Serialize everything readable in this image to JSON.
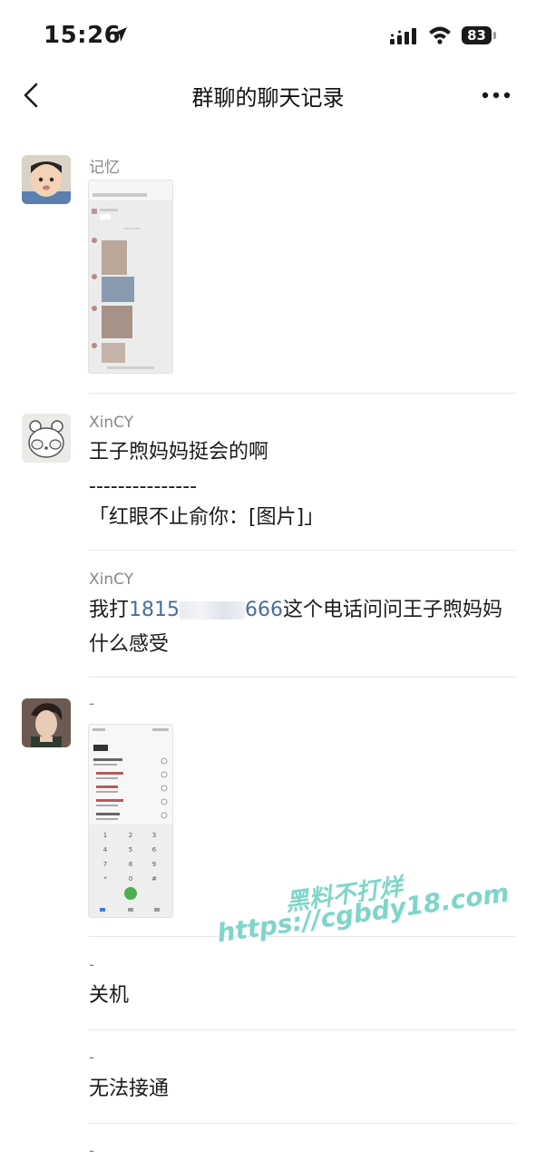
{
  "status": {
    "time": "15:26",
    "battery": "83"
  },
  "nav": {
    "title": "群聊的聊天记录"
  },
  "messages": [
    {
      "sender": "记忆"
    },
    {
      "sender": "XinCY",
      "line1": "王子煦妈妈挺会的啊",
      "separator": "---------------",
      "quote": "「红眼不止俞你：[图片]」"
    },
    {
      "sender": "XinCY",
      "prefix": "我打",
      "phone_start": "1815",
      "phone_end": "666",
      "suffix": "这个电话问问王子煦妈妈什么感受"
    },
    {
      "sender": "-"
    },
    {
      "sender": "-",
      "text": "关机"
    },
    {
      "sender": "-",
      "text": "无法接通"
    },
    {
      "sender": "-"
    }
  ],
  "watermark": {
    "line1": "黑料不打烊",
    "line2": "https://cgbdy18.com"
  }
}
